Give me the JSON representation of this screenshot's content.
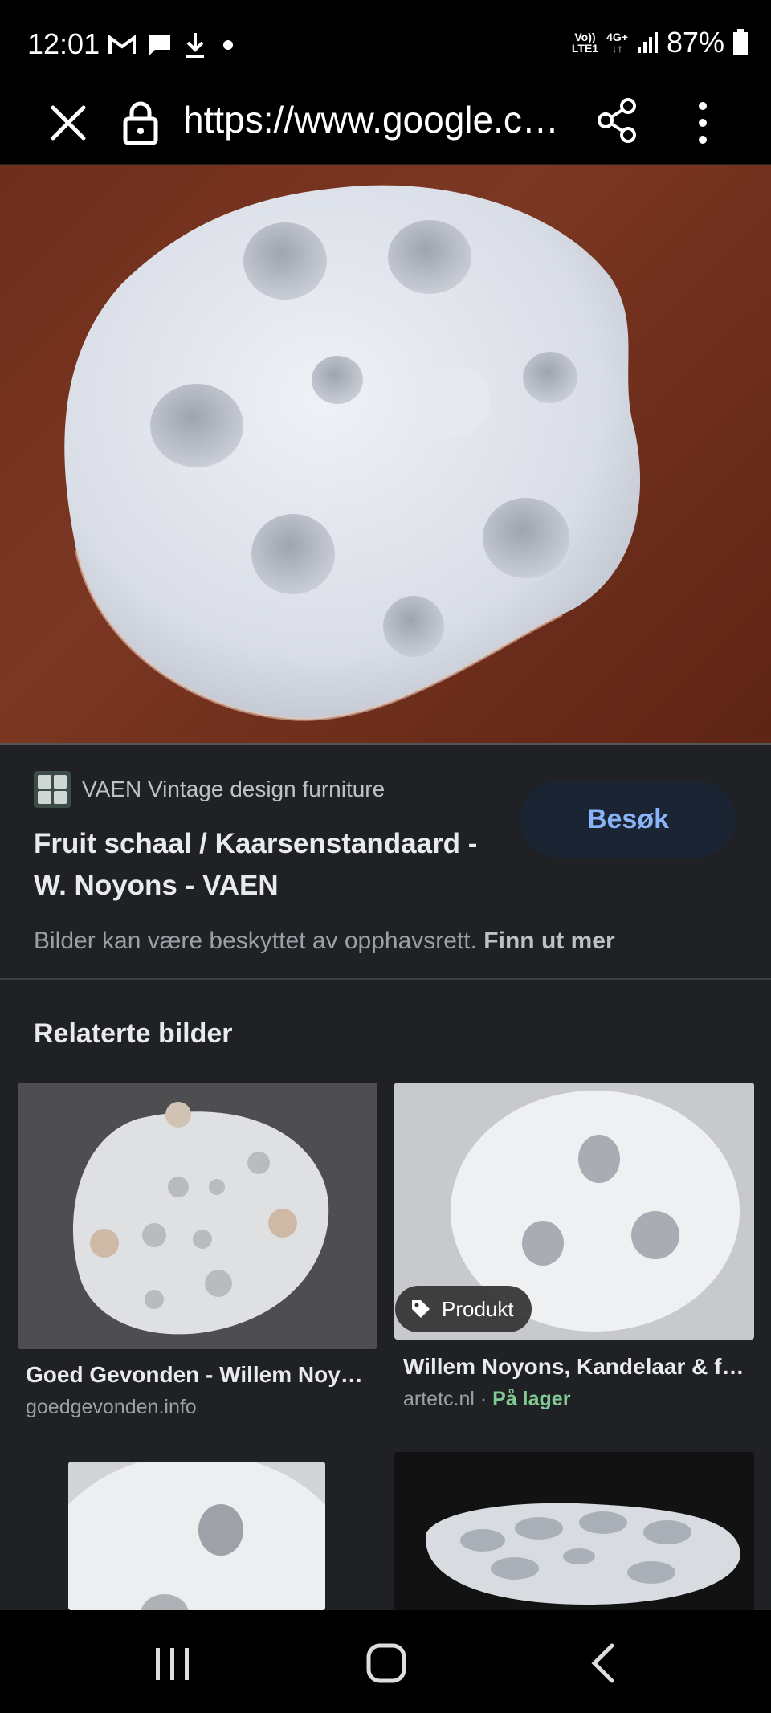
{
  "status_bar": {
    "time": "12:01",
    "signal_volte": "Vo))",
    "signal_lte": "LTE1",
    "network": "4G+",
    "battery": "87%"
  },
  "browser": {
    "url": "https://www.google.c…"
  },
  "result": {
    "source_name": "VAEN Vintage design furniture",
    "title": "Fruit schaal / Kaarsenstandaard - W. Noyons - VAEN",
    "visit_label": "Besøk",
    "copyright_text": "Bilder kan være beskyttet av opphavsrett.",
    "learn_more": "Finn ut mer"
  },
  "related": {
    "heading": "Relaterte bilder",
    "items": [
      {
        "title": "Goed Gevonden - Willem Noy…",
        "source": "goedgevonden.info"
      },
      {
        "title": "Willem Noyons, Kandelaar & f…",
        "source": "artetc.nl",
        "separator": " · ",
        "availability": "På lager",
        "badge": "Produkt"
      }
    ]
  },
  "colors": {
    "background": "#202124",
    "accent_link": "#8ab4f8",
    "in_stock": "#81c995"
  },
  "icons": [
    "close-icon",
    "lock-icon",
    "share-icon",
    "more-vert-icon",
    "gmail-icon",
    "chat-icon",
    "download-icon",
    "tag-icon",
    "recents-icon",
    "home-icon",
    "back-icon"
  ]
}
